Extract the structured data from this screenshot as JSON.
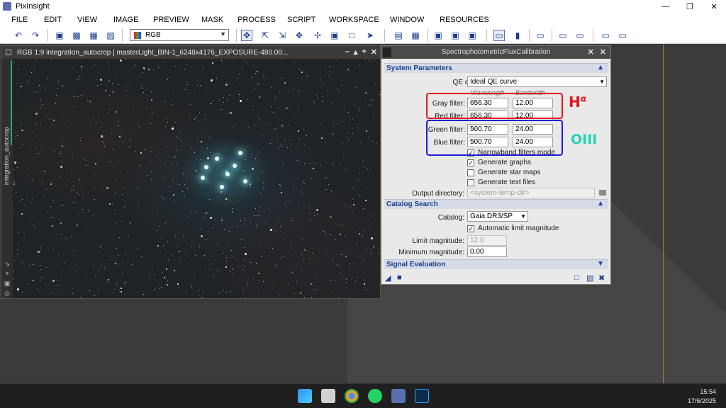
{
  "window": {
    "app_title": "PixInsight",
    "controls": [
      "—",
      "❐",
      "✕"
    ]
  },
  "menu": [
    "FILE",
    "EDIT",
    "VIEW",
    "IMAGE",
    "PREVIEW",
    "MASK",
    "PROCESS",
    "SCRIPT",
    "WORKSPACE",
    "WINDOW",
    "RESOURCES"
  ],
  "toolbar": {
    "channel_select": "RGB"
  },
  "image_window": {
    "title": "RGB 1:9 integration_autocrop | masterLight_BIN-1_6248x4176_EXPOSURE-480.00...",
    "tab_label": "integration_autocrop",
    "buttons": [
      "–",
      "▴",
      "+",
      "✕"
    ]
  },
  "process": {
    "title": "SpectrophotometricFluxCalibration",
    "header_buttons": [
      "✕",
      "✕"
    ],
    "system_params": {
      "section_label": "System Parameters",
      "qe_label": "QE curve:",
      "qe_value": "Ideal QE curve",
      "col_wavelength": "Wavelength",
      "col_bandwidth": "Bandwidth",
      "filters": [
        {
          "label": "Gray filter:",
          "wavelength": "656.30",
          "bandwidth": "12.00"
        },
        {
          "label": "Red filter:",
          "wavelength": "656.30",
          "bandwidth": "12.00"
        },
        {
          "label": "Green filter:",
          "wavelength": "500.70",
          "bandwidth": "24.00"
        },
        {
          "label": "Blue filter:",
          "wavelength": "500.70",
          "bandwidth": "24.00"
        }
      ],
      "checkboxes": [
        {
          "label": "Narrowband filters mode",
          "checked": true
        },
        {
          "label": "Generate graphs",
          "checked": true
        },
        {
          "label": "Generate star maps",
          "checked": false
        },
        {
          "label": "Generate text files",
          "checked": false
        }
      ],
      "output_label": "Output directory:",
      "output_placeholder": "<system-temp-dir>"
    },
    "catalog": {
      "section_label": "Catalog Search",
      "catalog_label": "Catalog:",
      "catalog_value": "Gaia DR3/SP",
      "auto_limit_label": "Automatic limit magnitude",
      "auto_limit_checked": true,
      "limit_label": "Limit magnitude:",
      "limit_value": "12.0",
      "min_label": "Minimum magnitude:",
      "min_value": "0.00"
    },
    "signal": {
      "section_label": "Signal Evaluation"
    }
  },
  "annotations": {
    "ha_label": "H",
    "ha_superscript": "α",
    "oiii_label": "OIII",
    "ha_color": "#e8141c",
    "oiii_color": "#1e1ed8",
    "oiii_text_color": "#22d3b0"
  },
  "taskbar": {
    "time": "15:54",
    "date": "17/6/2025"
  }
}
